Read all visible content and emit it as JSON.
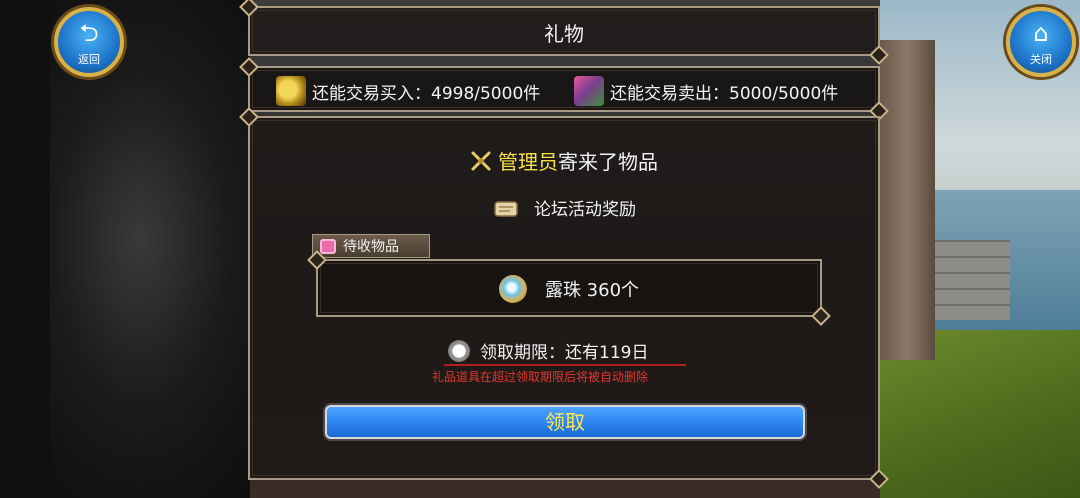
{
  "window": {
    "title": "礼物"
  },
  "nav": {
    "back_label": "返回",
    "back_icon": "back-arrow-icon",
    "close_label": "关闭",
    "close_icon": "home-icon"
  },
  "trade": {
    "buy_label": "还能交易买入：4998/5000件",
    "sell_label": "还能交易卖出：5000/5000件"
  },
  "mail": {
    "sender_name": "管理员",
    "sender_suffix": "寄来了物品",
    "subject": "论坛活动奖励",
    "pending_tab": "待收物品",
    "item_text": "露珠  360个",
    "deadline": "领取期限：还有119日",
    "warning": "礼品道具在超过领取期限后将被自动删除",
    "claim_button": "领取"
  },
  "colors": {
    "accent_blue": "#2f86f2",
    "sender_yellow": "#f5e04a",
    "warning_red": "#e2372e",
    "button_text": "#ffe94a"
  }
}
